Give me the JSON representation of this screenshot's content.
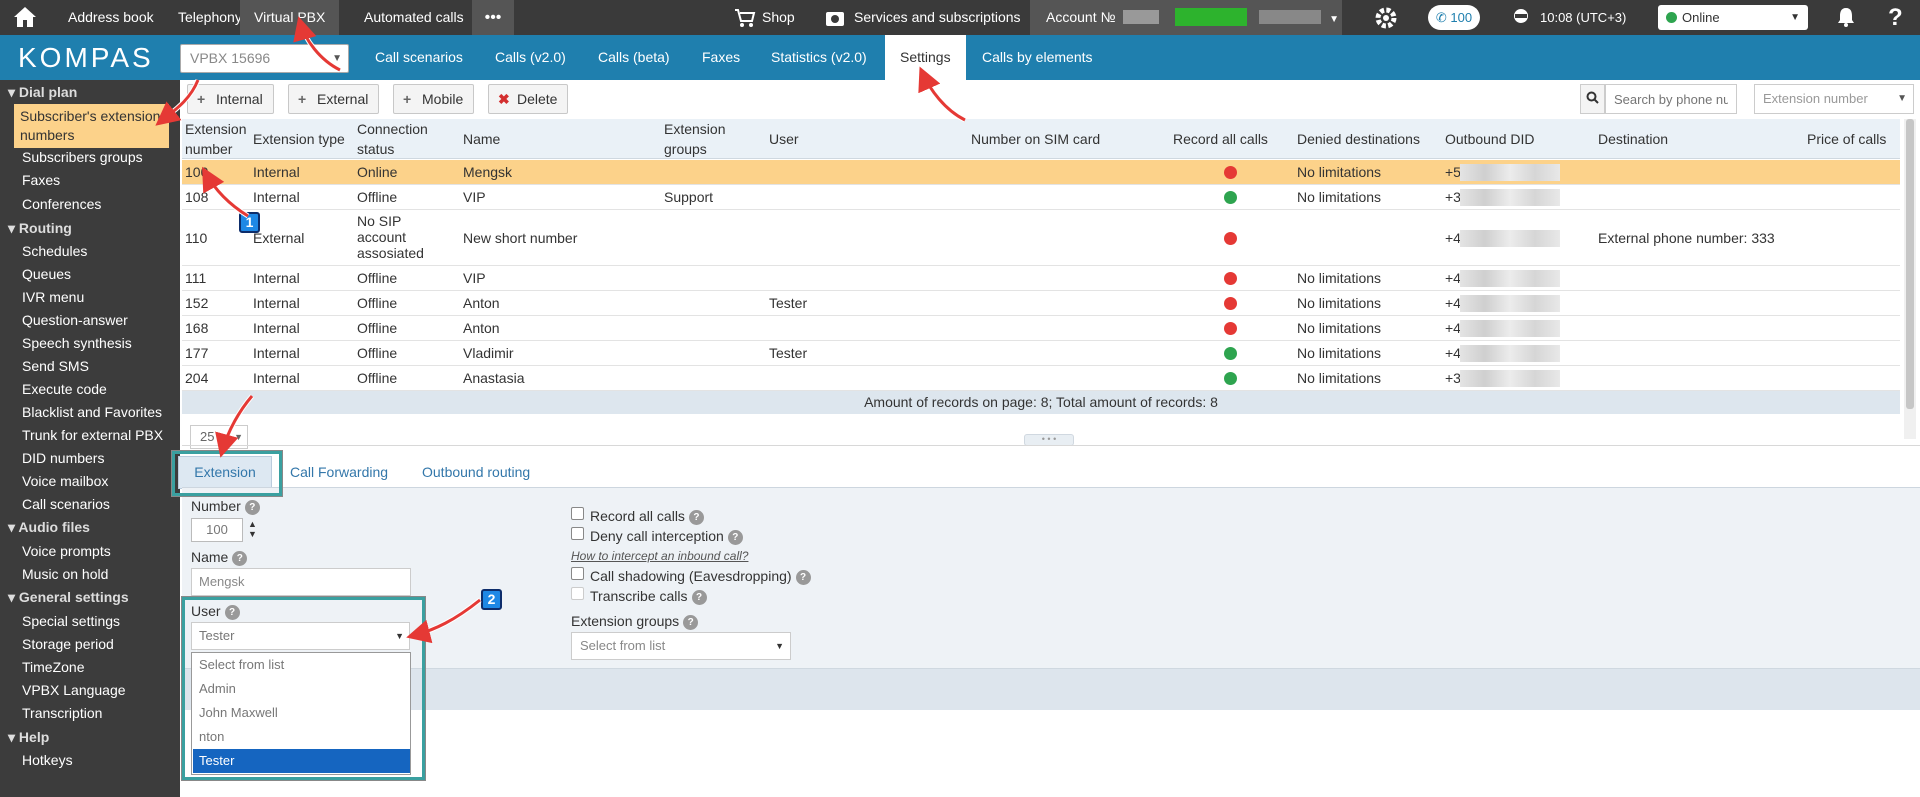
{
  "topbar": {
    "items": [
      "Address book",
      "Telephony",
      "Virtual PBX",
      "Automated calls"
    ],
    "more": "•••",
    "shop": "Shop",
    "services": "Services and subscriptions",
    "account": "Account №",
    "calls_count": "100",
    "time": "10:08 (UTC+3)",
    "status": "Online"
  },
  "navbar": {
    "logo": "KOMPAS",
    "vpbx_select": "VPBX 15696",
    "tabs": [
      "Call scenarios",
      "Calls (v2.0)",
      "Calls (beta)",
      "Faxes",
      "Statistics (v2.0)",
      "Settings",
      "Calls by elements"
    ],
    "active_tab": "Settings"
  },
  "sidebar": {
    "groups": [
      {
        "title": "Dial plan",
        "items": [
          "Subscriber's extension numbers",
          "Subscribers groups",
          "Faxes",
          "Conferences"
        ]
      },
      {
        "title": "Routing",
        "items": [
          "Schedules",
          "Queues",
          "IVR menu",
          "Question-answer",
          "Speech synthesis",
          "Send SMS",
          "Execute code",
          "Blacklist and Favorites",
          "Trunk for external PBX",
          "DID numbers",
          "Voice mailbox",
          "Call scenarios"
        ]
      },
      {
        "title": "Audio files",
        "items": [
          "Voice prompts",
          "Music on hold"
        ]
      },
      {
        "title": "General settings",
        "items": [
          "Special settings",
          "Storage period",
          "TimeZone",
          "VPBX Language",
          "Transcription"
        ]
      },
      {
        "title": "Help",
        "items": [
          "Hotkeys"
        ]
      }
    ]
  },
  "toolbar": {
    "internal": "Internal",
    "external": "External",
    "mobile": "Mobile",
    "delete": "Delete",
    "search_placeholder": "Search by phone number",
    "filter": "Extension number"
  },
  "table": {
    "headers": [
      "Extension number",
      "Extension type",
      "Connection status",
      "Name",
      "Extension groups",
      "User",
      "Number on SIM card",
      "Record all calls",
      "Denied destinations",
      "Outbound DID",
      "Destination",
      "Price of calls"
    ],
    "rows": [
      {
        "number": "100",
        "type": "Internal",
        "status": "Online",
        "name": "Mengsk",
        "groups": "",
        "user": "",
        "record": "red",
        "denied": "No limitations",
        "did": "+5",
        "destination": ""
      },
      {
        "number": "108",
        "type": "Internal",
        "status": "Offline",
        "name": "VIP",
        "groups": "Support",
        "user": "",
        "record": "green",
        "denied": "No limitations",
        "did": "+3",
        "destination": ""
      },
      {
        "number": "110",
        "type": "External",
        "status": "No SIP account assosiated",
        "name": "New short number",
        "groups": "",
        "user": "",
        "record": "red",
        "denied": "",
        "did": "+4",
        "destination": "External phone number: 333"
      },
      {
        "number": "111",
        "type": "Internal",
        "status": "Offline",
        "name": "VIP",
        "groups": "",
        "user": "",
        "record": "red",
        "denied": "No limitations",
        "did": "+4",
        "destination": ""
      },
      {
        "number": "152",
        "type": "Internal",
        "status": "Offline",
        "name": "Anton",
        "groups": "",
        "user": "Tester",
        "record": "red",
        "denied": "No limitations",
        "did": "+4",
        "destination": ""
      },
      {
        "number": "168",
        "type": "Internal",
        "status": "Offline",
        "name": "Anton",
        "groups": "",
        "user": "",
        "record": "red",
        "denied": "No limitations",
        "did": "+4",
        "destination": ""
      },
      {
        "number": "177",
        "type": "Internal",
        "status": "Offline",
        "name": "Vladimir",
        "groups": "",
        "user": "Tester",
        "record": "green",
        "denied": "No limitations",
        "did": "+4",
        "destination": ""
      },
      {
        "number": "204",
        "type": "Internal",
        "status": "Offline",
        "name": "Anastasia",
        "groups": "",
        "user": "",
        "record": "green",
        "denied": "No limitations",
        "did": "+3",
        "destination": ""
      }
    ],
    "footer": "Amount of records on page: 8; Total amount of records: 8",
    "page_size": "25"
  },
  "colors": {
    "red": "#e53935",
    "green": "#2ea44f",
    "accent": "#1f7fae",
    "highlight": "#fcd28a"
  },
  "bottom_tabs": [
    "Extension",
    "Call Forwarding",
    "Outbound routing"
  ],
  "form": {
    "number_label": "Number",
    "number_value": "100",
    "name_label": "Name",
    "name_value": "Mengsk",
    "user_label": "User",
    "user_value": "Tester",
    "user_options": [
      "Select from list",
      "Admin",
      "John Maxwell",
      "nton",
      "Tester"
    ],
    "record_all": "Record all calls",
    "deny_intercept": "Deny call interception",
    "intercept_link": "How to intercept an inbound call?",
    "shadowing": "Call shadowing (Eavesdropping)",
    "transcribe": "Transcribe calls",
    "ext_groups_label": "Extension groups",
    "ext_groups_value": "Select from list",
    "help": "?"
  },
  "annotations": {
    "marker1": "1",
    "marker2": "2"
  }
}
